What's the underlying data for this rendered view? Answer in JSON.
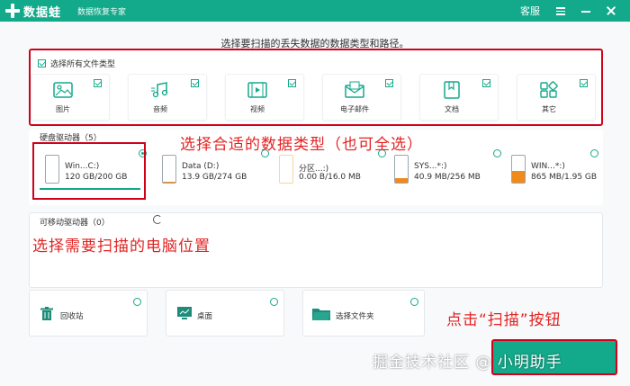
{
  "titlebar": {
    "brand": "数据蛙",
    "subtitle": "数据恢复专家",
    "service": "客服"
  },
  "instruction": "选择要扫描的丢失数据的数据类型和路径。",
  "file_types": {
    "select_all_label": "选择所有文件类型",
    "items": [
      {
        "label": "图片",
        "icon": "image-icon"
      },
      {
        "label": "音频",
        "icon": "music-icon"
      },
      {
        "label": "视频",
        "icon": "video-icon"
      },
      {
        "label": "电子邮件",
        "icon": "email-icon"
      },
      {
        "label": "文档",
        "icon": "document-icon"
      },
      {
        "label": "其它",
        "icon": "other-icon"
      }
    ]
  },
  "annotations": {
    "types": "选择合适的数据类型（也可全选）",
    "location": "选择需要扫描的电脑位置",
    "scan": "点击“扫描”按钮"
  },
  "hard_drives": {
    "title": "硬盘驱动器（5）",
    "items": [
      {
        "name": "Win...C:)",
        "size": "120 GB/200 GB",
        "selected": true,
        "fill": 0.6
      },
      {
        "name": "Data (D:)",
        "size": "13.9 GB/274 GB",
        "selected": false,
        "fill": 0.05
      },
      {
        "name": "分区...:)",
        "size": "0.00  B/16.0 MB",
        "selected": false,
        "fill": 0
      },
      {
        "name": "SYS...*:)",
        "size": "40.9 MB/256 MB",
        "selected": false,
        "fill": 0.16
      },
      {
        "name": "WIN...*:)",
        "size": "865 MB/1.95 GB",
        "selected": false,
        "fill": 0.44
      }
    ]
  },
  "removable": {
    "title": "可移动驱动器（0）"
  },
  "locations": [
    {
      "label": "回收站",
      "icon": "recycle-bin-icon"
    },
    {
      "label": "桌面",
      "icon": "desktop-icon"
    },
    {
      "label": "选择文件夹",
      "icon": "folder-icon"
    }
  ],
  "watermark": "掘金技术社区 @ 小明助手",
  "colors": {
    "accent": "#13a98b",
    "highlight": "#d0021b",
    "annotation": "#e32222",
    "drive_fill": "#f08a1b"
  }
}
